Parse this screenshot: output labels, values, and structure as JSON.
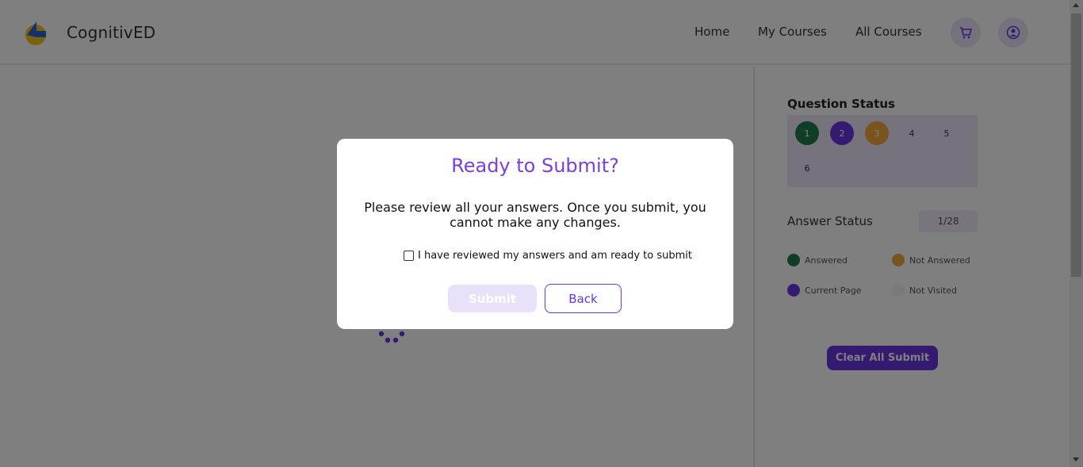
{
  "header": {
    "brand": "CognitivED",
    "nav": {
      "home": "Home",
      "my_courses": "My Courses",
      "all_courses": "All Courses"
    },
    "icons": {
      "logo": "logo-icon",
      "cart": "cart-icon",
      "profile": "profile-icon"
    }
  },
  "sidebar": {
    "question_status_title": "Question Status",
    "questions": [
      {
        "label": "1",
        "status": "answered",
        "color": "#1f7a4d"
      },
      {
        "label": "2",
        "status": "current",
        "color": "#6b35e3"
      },
      {
        "label": "3",
        "status": "not-answered",
        "color": "#f2a93b"
      },
      {
        "label": "4",
        "status": "not-visited",
        "color": ""
      },
      {
        "label": "5",
        "status": "not-visited",
        "color": ""
      },
      {
        "label": "6",
        "status": "not-visited",
        "color": ""
      }
    ],
    "answer_status_title": "Answer Status",
    "count_label": "1/28",
    "legend": {
      "answered": "Answered",
      "not_answered": "Not Answered",
      "current_page": "Current Page",
      "not_visited": "Not Visited"
    },
    "clear_submit_label": "Clear All Submit"
  },
  "modal": {
    "title": "Ready to Submit?",
    "message": "Please review all your answers. Once you submit, you cannot make any changes.",
    "checkbox_label": "I have reviewed my answers and am ready to submit",
    "checkbox_checked": false,
    "submit_label": "Submit",
    "back_label": "Back"
  },
  "colors": {
    "accent": "#7b3fe4",
    "answered": "#1f7a4d",
    "not_answered": "#f2a93b",
    "current": "#6b35e3"
  }
}
